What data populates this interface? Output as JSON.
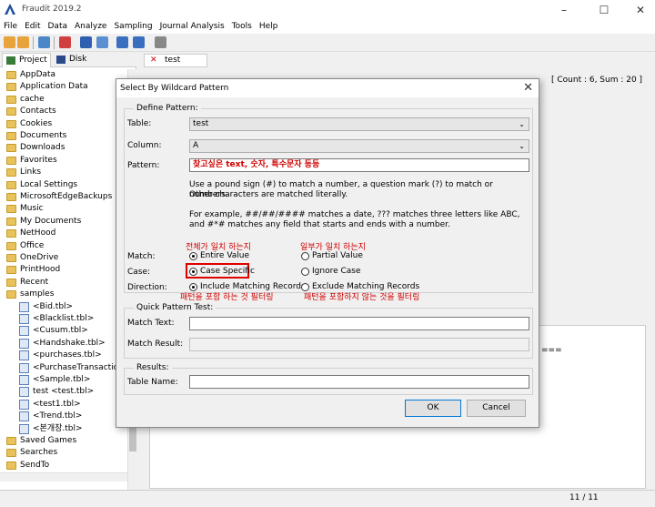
{
  "app": {
    "title": "Fraudit 2019.2"
  },
  "menu": [
    "File",
    "Edit",
    "Data",
    "Analyze",
    "Sampling",
    "Journal Analysis",
    "Tools",
    "Help"
  ],
  "left_tabs": [
    "Project",
    "Disk"
  ],
  "tree_items": [
    {
      "label": "AppData",
      "type": "folder",
      "indent": 0
    },
    {
      "label": "Application Data",
      "type": "folder",
      "indent": 0
    },
    {
      "label": "cache",
      "type": "folder",
      "indent": 0
    },
    {
      "label": "Contacts",
      "type": "folder",
      "indent": 0
    },
    {
      "label": "Cookies",
      "type": "folder",
      "indent": 0
    },
    {
      "label": "Documents",
      "type": "folder",
      "indent": 0
    },
    {
      "label": "Downloads",
      "type": "folder",
      "indent": 0
    },
    {
      "label": "Favorites",
      "type": "folder",
      "indent": 0
    },
    {
      "label": "Links",
      "type": "folder",
      "indent": 0
    },
    {
      "label": "Local Settings",
      "type": "folder",
      "indent": 0
    },
    {
      "label": "MicrosoftEdgeBackups",
      "type": "folder",
      "indent": 0
    },
    {
      "label": "Music",
      "type": "folder",
      "indent": 0
    },
    {
      "label": "My Documents",
      "type": "folder",
      "indent": 0
    },
    {
      "label": "NetHood",
      "type": "folder",
      "indent": 0
    },
    {
      "label": "Office",
      "type": "folder",
      "indent": 0
    },
    {
      "label": "OneDrive",
      "type": "folder",
      "indent": 0
    },
    {
      "label": "PrintHood",
      "type": "folder",
      "indent": 0
    },
    {
      "label": "Recent",
      "type": "folder",
      "indent": 0
    },
    {
      "label": "samples",
      "type": "folder",
      "indent": 0
    },
    {
      "label": "<Bid.tbl>",
      "type": "file",
      "indent": 1
    },
    {
      "label": "<Blacklist.tbl>",
      "type": "file",
      "indent": 1
    },
    {
      "label": "<Cusum.tbl>",
      "type": "file",
      "indent": 1
    },
    {
      "label": "<Handshake.tbl>",
      "type": "file",
      "indent": 1
    },
    {
      "label": "<purchases.tbl>",
      "type": "file",
      "indent": 1
    },
    {
      "label": "<PurchaseTransaction.tbl>",
      "type": "file",
      "indent": 1
    },
    {
      "label": "<Sample.tbl>",
      "type": "file",
      "indent": 1
    },
    {
      "label": "test <test.tbl>",
      "type": "file",
      "indent": 1
    },
    {
      "label": "<test1.tbl>",
      "type": "file",
      "indent": 1
    },
    {
      "label": "<Trend.tbl>",
      "type": "file",
      "indent": 1
    },
    {
      "label": "<본개장.tbl>",
      "type": "file",
      "indent": 1
    },
    {
      "label": "Saved Games",
      "type": "folder",
      "indent": 0
    },
    {
      "label": "Searches",
      "type": "folder",
      "indent": 0
    },
    {
      "label": "SendTo",
      "type": "folder",
      "indent": 0
    }
  ],
  "doc": {
    "tab_label": "test",
    "count_label": "[ Count : 6, Sum : 20 ]",
    "hidden_tail": "==="
  },
  "status": {
    "page": "11 / 11"
  },
  "dialog": {
    "title": "Select By Wildcard Pattern",
    "define_pattern": {
      "legend": "Define Pattern:",
      "table_label": "Table:",
      "table_value": "test",
      "column_label": "Column:",
      "column_value": "A",
      "pattern_label": "Pattern:",
      "pattern_value": "찾고싶은 text, 숫자, 특수문자 등등",
      "help1": "Use a pound sign (#) to match a number, a question mark (?) to match or numbers.",
      "help2": "Other characters are matched literally.",
      "help3": "For example, ##/##/#### matches a date, ??? matches three letters like ABC,",
      "help4": "and #*# matches any field that starts and ends with a number.",
      "match_label": "Match:",
      "match_entire": "Entire Value",
      "match_partial": "Partial Value",
      "case_label": "Case:",
      "case_specific": "Case Specific",
      "case_ignore": "Ignore Case",
      "direction_label": "Direction:",
      "direction_include": "Include Matching Records",
      "direction_exclude": "Exclude Matching Records",
      "selected": {
        "match": "Entire Value",
        "case": "Case Specific",
        "direction": "Include Matching Records"
      }
    },
    "annotations": {
      "entire": "전체가 일치 하는지",
      "partial": "일부가 일치 하는지",
      "include": "패턴을 포함 하는 것 필터링",
      "exclude": "패턴을 포함하지 않는 것을 필터링"
    },
    "quick_test": {
      "legend": "Quick Pattern Test:",
      "match_text_label": "Match Text:",
      "match_result_label": "Match Result:"
    },
    "results": {
      "legend": "Results:",
      "table_name_label": "Table Name:"
    },
    "ok": "OK",
    "cancel": "Cancel"
  },
  "colors": {
    "annotation": "#d00000",
    "highlight_box": "#e00000",
    "folder": "#e8c25a"
  }
}
